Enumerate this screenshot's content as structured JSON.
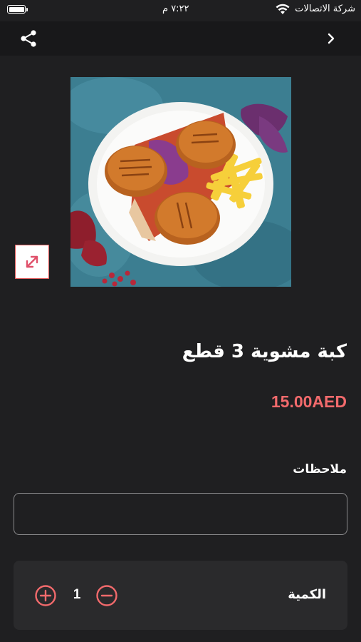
{
  "status_bar": {
    "time": "٧:٢٢ م",
    "carrier": "شركة الاتصالات",
    "wifi_icon": "wifi-icon",
    "battery_icon": "battery-icon"
  },
  "nav": {
    "share_icon": "share-icon",
    "back_icon": "chevron-right-icon"
  },
  "product": {
    "image_subject": "kibbeh-plate-photo",
    "expand_icon": "expand-arrows-icon",
    "title": "كبة مشوية 3 قطع",
    "price": "15.00AED"
  },
  "notes": {
    "label": "ملاحظات",
    "value": "",
    "placeholder": ""
  },
  "quantity": {
    "label": "الكمية",
    "value": "1",
    "plus_icon": "plus-circle-icon",
    "minus_icon": "minus-circle-icon"
  },
  "colors": {
    "background": "#1f1f21",
    "nav_background": "#18181a",
    "accent": "#f26a6c",
    "card": "#2a2a2c"
  }
}
